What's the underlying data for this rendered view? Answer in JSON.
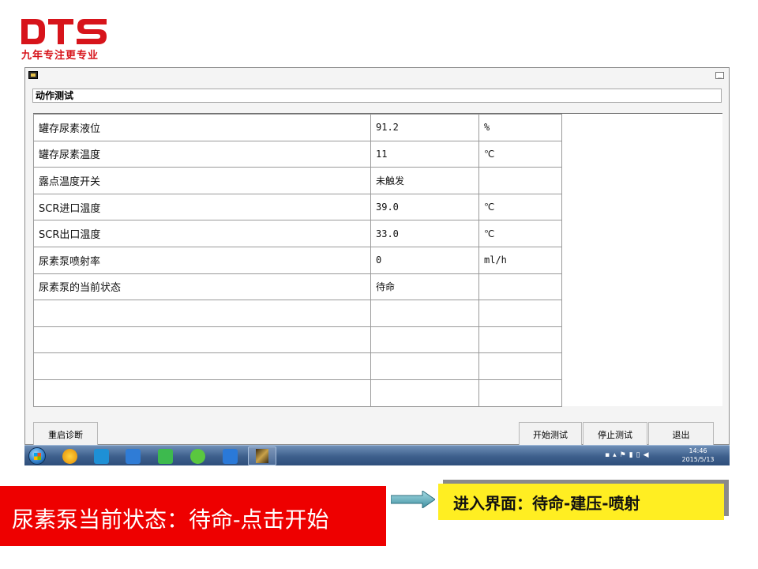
{
  "brand": {
    "name": "DTS",
    "tagline": "九年专注更专业",
    "color": "#d7141b"
  },
  "window": {
    "minimize_glyph": "_",
    "section_title": "动作测试",
    "rows": [
      {
        "label": "罐存尿素液位",
        "value": "91.2",
        "unit": "%"
      },
      {
        "label": "罐存尿素温度",
        "value": "11",
        "unit": "℃"
      },
      {
        "label": "露点温度开关",
        "value": "未触发",
        "unit": ""
      },
      {
        "label": "SCR进口温度",
        "value": "39.0",
        "unit": "℃"
      },
      {
        "label": "SCR出口温度",
        "value": "33.0",
        "unit": "℃"
      },
      {
        "label": "尿素泵喷射率",
        "value": "0",
        "unit": "ml/h"
      },
      {
        "label": "尿素泵的当前状态",
        "value": "待命",
        "unit": ""
      },
      {
        "label": "",
        "value": "",
        "unit": ""
      },
      {
        "label": "",
        "value": "",
        "unit": ""
      },
      {
        "label": "",
        "value": "",
        "unit": ""
      },
      {
        "label": "",
        "value": "",
        "unit": ""
      }
    ],
    "buttons": {
      "restart": "重启诊断",
      "start": "开始测试",
      "stop": "停止测试",
      "exit": "退出"
    }
  },
  "taskbar": {
    "time": "14:46",
    "date": "2015/5/13"
  },
  "annotations": {
    "red_banner": "尿素泵当前状态：待命-点击开始",
    "yellow_box": "进入界面：待命-建压-喷射",
    "red_color": "#ee0000",
    "yellow_color": "#ffee22"
  }
}
